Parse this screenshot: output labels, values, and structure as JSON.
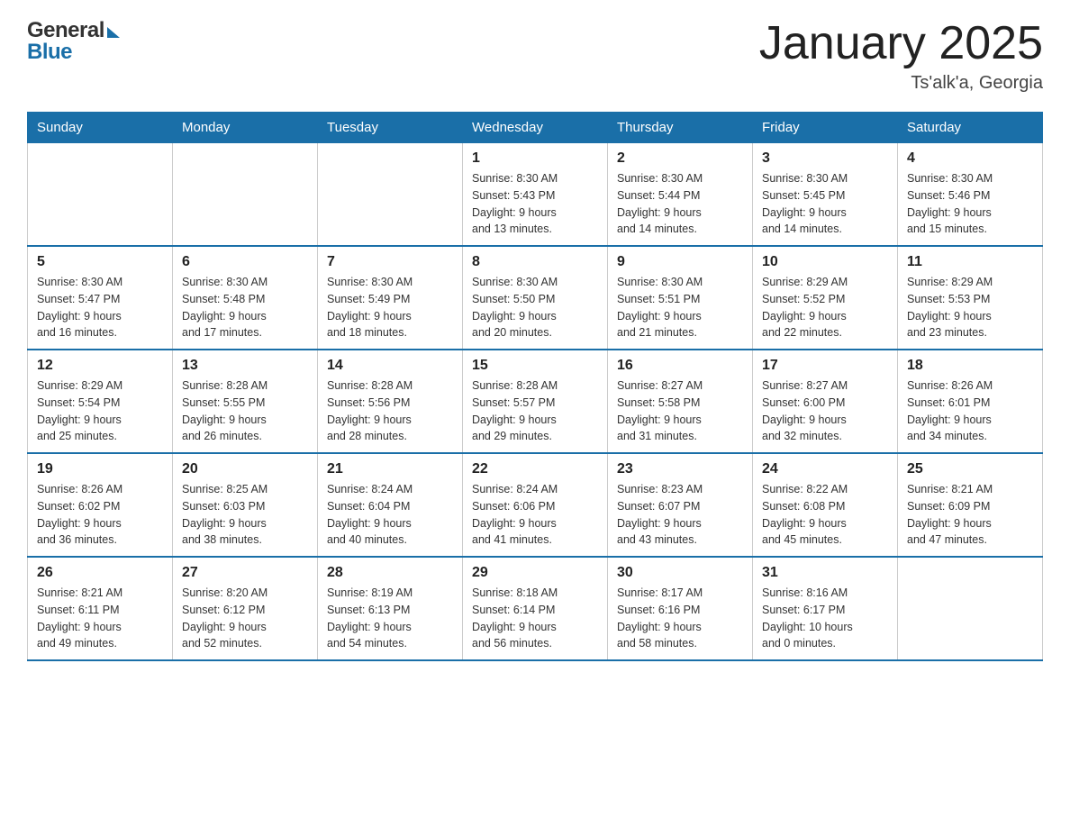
{
  "header": {
    "title": "January 2025",
    "location": "Ts'alk'a, Georgia",
    "logo_general": "General",
    "logo_blue": "Blue"
  },
  "days_of_week": [
    "Sunday",
    "Monday",
    "Tuesday",
    "Wednesday",
    "Thursday",
    "Friday",
    "Saturday"
  ],
  "weeks": [
    [
      {
        "day": "",
        "info": ""
      },
      {
        "day": "",
        "info": ""
      },
      {
        "day": "",
        "info": ""
      },
      {
        "day": "1",
        "info": "Sunrise: 8:30 AM\nSunset: 5:43 PM\nDaylight: 9 hours\nand 13 minutes."
      },
      {
        "day": "2",
        "info": "Sunrise: 8:30 AM\nSunset: 5:44 PM\nDaylight: 9 hours\nand 14 minutes."
      },
      {
        "day": "3",
        "info": "Sunrise: 8:30 AM\nSunset: 5:45 PM\nDaylight: 9 hours\nand 14 minutes."
      },
      {
        "day": "4",
        "info": "Sunrise: 8:30 AM\nSunset: 5:46 PM\nDaylight: 9 hours\nand 15 minutes."
      }
    ],
    [
      {
        "day": "5",
        "info": "Sunrise: 8:30 AM\nSunset: 5:47 PM\nDaylight: 9 hours\nand 16 minutes."
      },
      {
        "day": "6",
        "info": "Sunrise: 8:30 AM\nSunset: 5:48 PM\nDaylight: 9 hours\nand 17 minutes."
      },
      {
        "day": "7",
        "info": "Sunrise: 8:30 AM\nSunset: 5:49 PM\nDaylight: 9 hours\nand 18 minutes."
      },
      {
        "day": "8",
        "info": "Sunrise: 8:30 AM\nSunset: 5:50 PM\nDaylight: 9 hours\nand 20 minutes."
      },
      {
        "day": "9",
        "info": "Sunrise: 8:30 AM\nSunset: 5:51 PM\nDaylight: 9 hours\nand 21 minutes."
      },
      {
        "day": "10",
        "info": "Sunrise: 8:29 AM\nSunset: 5:52 PM\nDaylight: 9 hours\nand 22 minutes."
      },
      {
        "day": "11",
        "info": "Sunrise: 8:29 AM\nSunset: 5:53 PM\nDaylight: 9 hours\nand 23 minutes."
      }
    ],
    [
      {
        "day": "12",
        "info": "Sunrise: 8:29 AM\nSunset: 5:54 PM\nDaylight: 9 hours\nand 25 minutes."
      },
      {
        "day": "13",
        "info": "Sunrise: 8:28 AM\nSunset: 5:55 PM\nDaylight: 9 hours\nand 26 minutes."
      },
      {
        "day": "14",
        "info": "Sunrise: 8:28 AM\nSunset: 5:56 PM\nDaylight: 9 hours\nand 28 minutes."
      },
      {
        "day": "15",
        "info": "Sunrise: 8:28 AM\nSunset: 5:57 PM\nDaylight: 9 hours\nand 29 minutes."
      },
      {
        "day": "16",
        "info": "Sunrise: 8:27 AM\nSunset: 5:58 PM\nDaylight: 9 hours\nand 31 minutes."
      },
      {
        "day": "17",
        "info": "Sunrise: 8:27 AM\nSunset: 6:00 PM\nDaylight: 9 hours\nand 32 minutes."
      },
      {
        "day": "18",
        "info": "Sunrise: 8:26 AM\nSunset: 6:01 PM\nDaylight: 9 hours\nand 34 minutes."
      }
    ],
    [
      {
        "day": "19",
        "info": "Sunrise: 8:26 AM\nSunset: 6:02 PM\nDaylight: 9 hours\nand 36 minutes."
      },
      {
        "day": "20",
        "info": "Sunrise: 8:25 AM\nSunset: 6:03 PM\nDaylight: 9 hours\nand 38 minutes."
      },
      {
        "day": "21",
        "info": "Sunrise: 8:24 AM\nSunset: 6:04 PM\nDaylight: 9 hours\nand 40 minutes."
      },
      {
        "day": "22",
        "info": "Sunrise: 8:24 AM\nSunset: 6:06 PM\nDaylight: 9 hours\nand 41 minutes."
      },
      {
        "day": "23",
        "info": "Sunrise: 8:23 AM\nSunset: 6:07 PM\nDaylight: 9 hours\nand 43 minutes."
      },
      {
        "day": "24",
        "info": "Sunrise: 8:22 AM\nSunset: 6:08 PM\nDaylight: 9 hours\nand 45 minutes."
      },
      {
        "day": "25",
        "info": "Sunrise: 8:21 AM\nSunset: 6:09 PM\nDaylight: 9 hours\nand 47 minutes."
      }
    ],
    [
      {
        "day": "26",
        "info": "Sunrise: 8:21 AM\nSunset: 6:11 PM\nDaylight: 9 hours\nand 49 minutes."
      },
      {
        "day": "27",
        "info": "Sunrise: 8:20 AM\nSunset: 6:12 PM\nDaylight: 9 hours\nand 52 minutes."
      },
      {
        "day": "28",
        "info": "Sunrise: 8:19 AM\nSunset: 6:13 PM\nDaylight: 9 hours\nand 54 minutes."
      },
      {
        "day": "29",
        "info": "Sunrise: 8:18 AM\nSunset: 6:14 PM\nDaylight: 9 hours\nand 56 minutes."
      },
      {
        "day": "30",
        "info": "Sunrise: 8:17 AM\nSunset: 6:16 PM\nDaylight: 9 hours\nand 58 minutes."
      },
      {
        "day": "31",
        "info": "Sunrise: 8:16 AM\nSunset: 6:17 PM\nDaylight: 10 hours\nand 0 minutes."
      },
      {
        "day": "",
        "info": ""
      }
    ]
  ]
}
